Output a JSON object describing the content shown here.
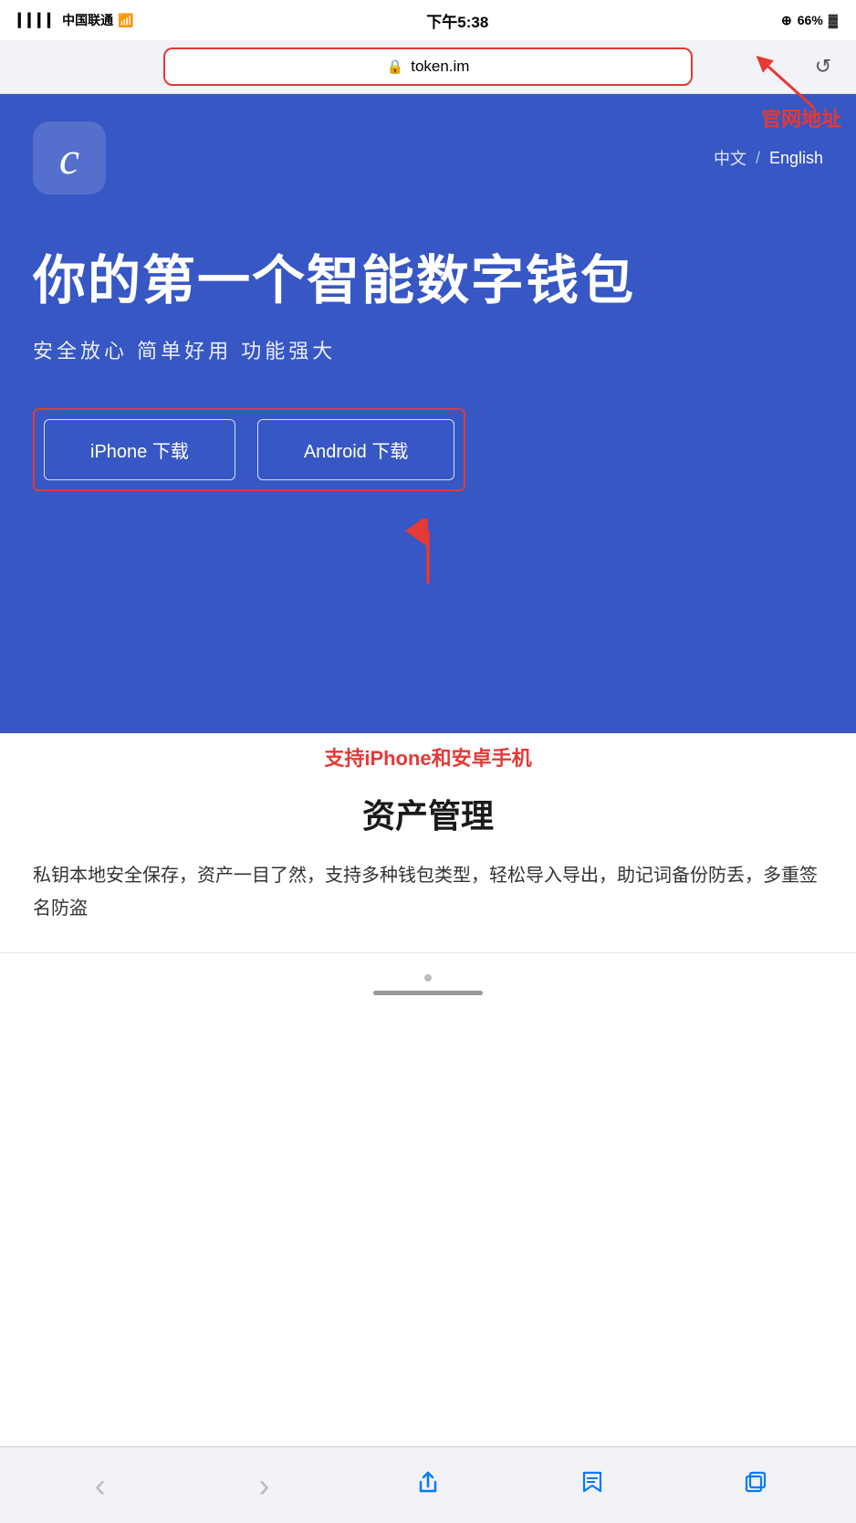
{
  "status_bar": {
    "carrier": "中国联通",
    "time": "下午5:38",
    "battery": "66%",
    "battery_icon": "🔋"
  },
  "browser": {
    "url": "token.im",
    "lock_symbol": "🔒",
    "reload_symbol": "↺"
  },
  "annotation": {
    "official_label": "官网地址",
    "support_label": "支持iPhone和安卓手机"
  },
  "hero": {
    "logo_symbol": "c",
    "lang_cn": "中文",
    "lang_separator": "/",
    "lang_en": "English",
    "title": "你的第一个智能数字钱包",
    "subtitle": "安全放心  简单好用  功能强大",
    "iphone_btn": "iPhone 下载",
    "android_btn": "Android 下载"
  },
  "content": {
    "section_title": "资产管理",
    "section_body": "私钥本地安全保存，资产一目了然，支持多种钱包类型，轻松导入导出，助记词备份防丢，多重签名防盗"
  },
  "safari_nav": {
    "back": "‹",
    "forward": "›",
    "share": "⬆",
    "bookmarks": "📖",
    "tabs": "⧉"
  }
}
